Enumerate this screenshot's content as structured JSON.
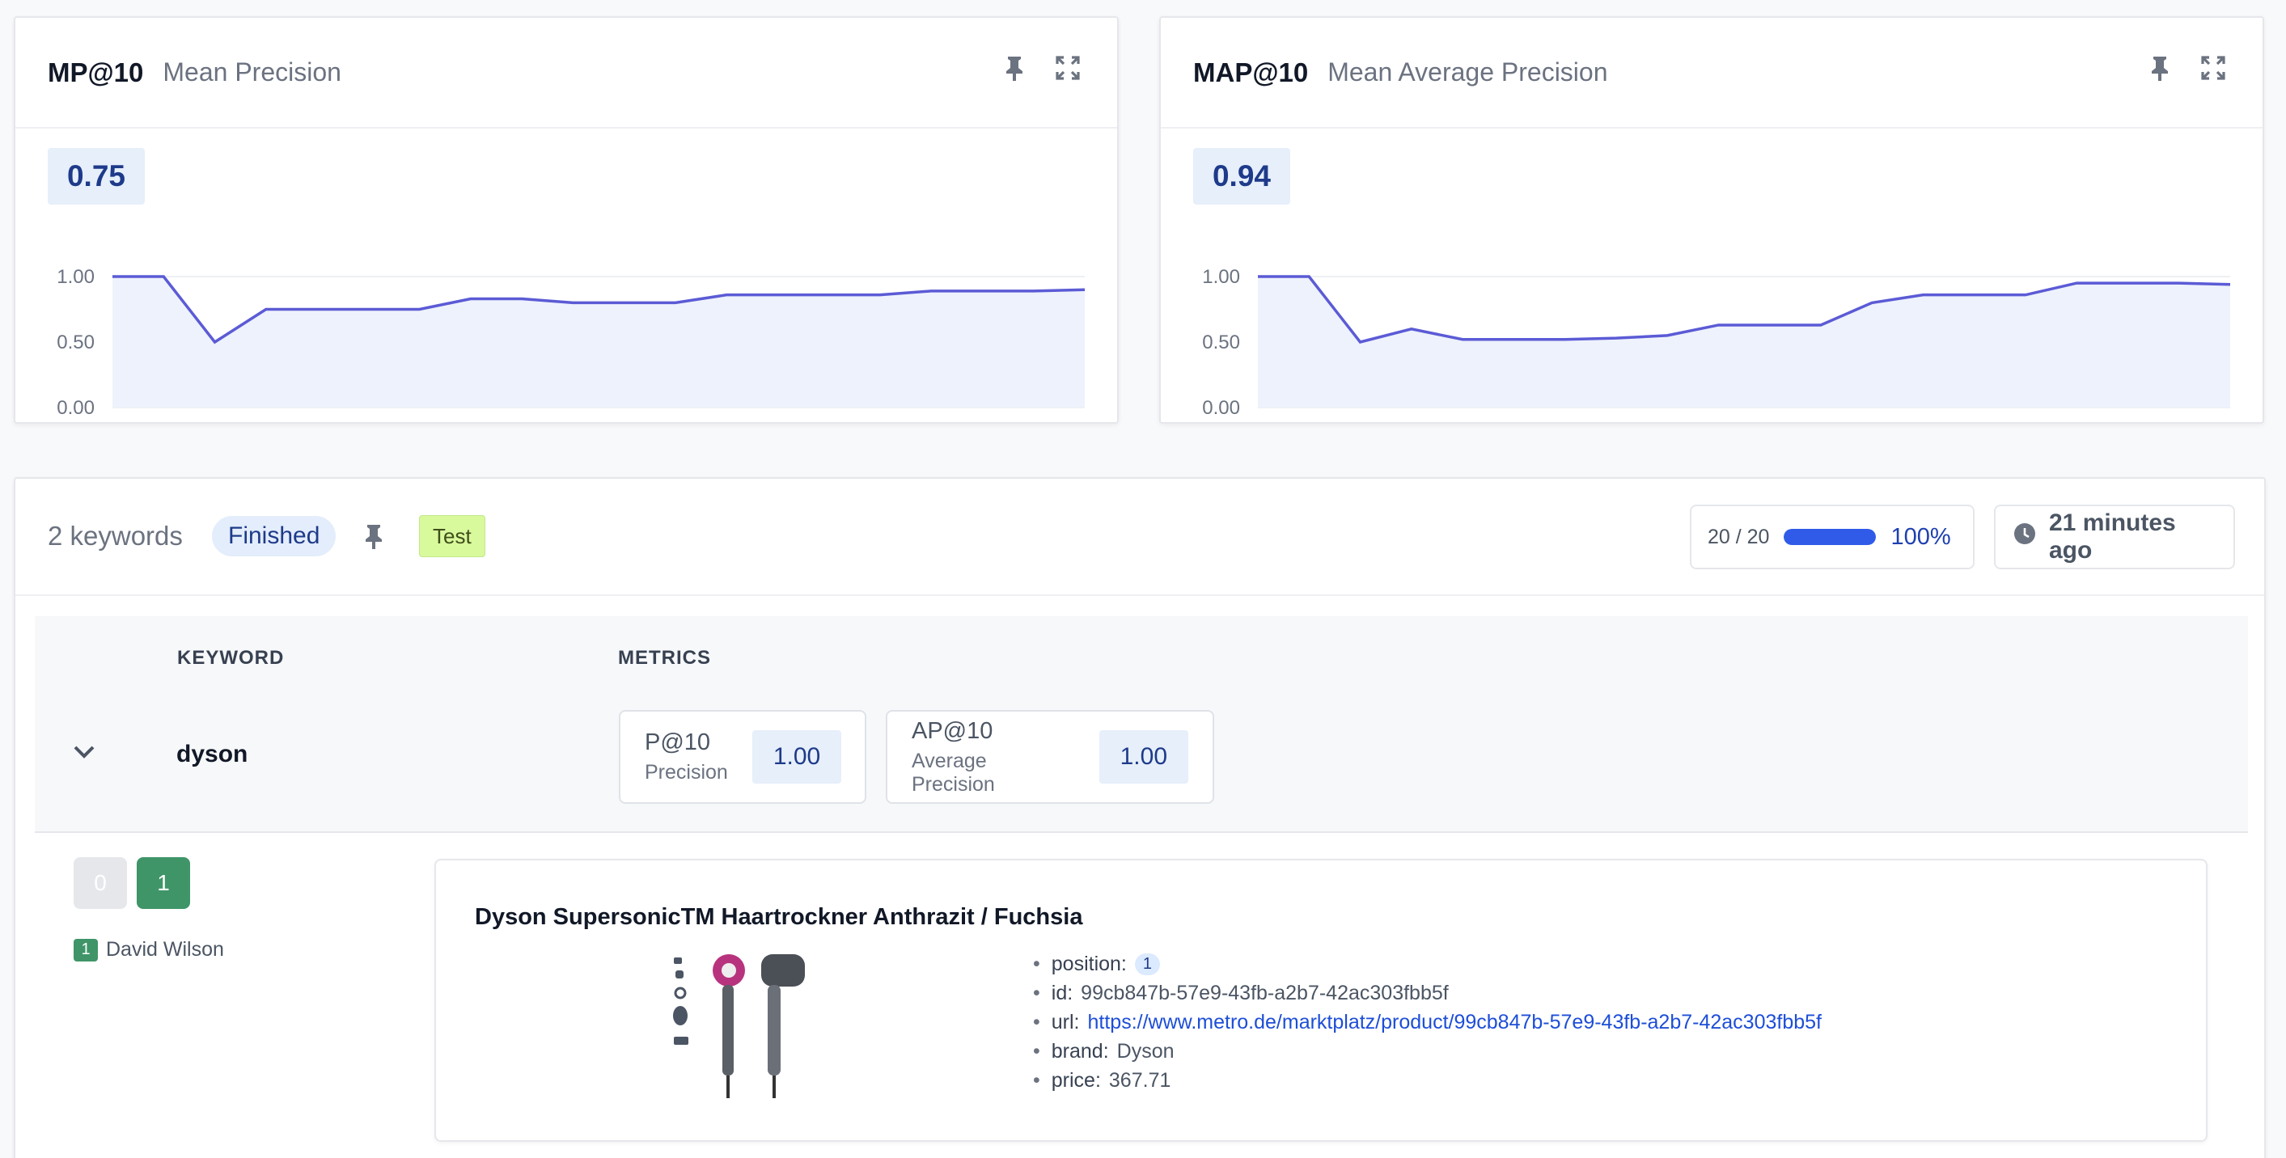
{
  "metric_cards": [
    {
      "code": "MP@10",
      "desc": "Mean Precision",
      "value": "0.75",
      "chart_data": {
        "type": "area",
        "x": [
          1,
          2,
          3,
          4,
          5,
          6,
          7,
          8,
          9,
          10,
          11,
          12,
          13,
          14,
          15,
          16,
          17,
          18,
          19,
          20
        ],
        "values": [
          1.0,
          1.0,
          0.5,
          0.75,
          0.75,
          0.75,
          0.75,
          0.83,
          0.83,
          0.8,
          0.8,
          0.8,
          0.86,
          0.86,
          0.86,
          0.86,
          0.89,
          0.89,
          0.89,
          0.9
        ],
        "ylim": [
          0,
          1
        ],
        "yticks": [
          "1.00",
          "0.50",
          "0.00"
        ],
        "grid": true
      }
    },
    {
      "code": "MAP@10",
      "desc": "Mean Average Precision",
      "value": "0.94",
      "chart_data": {
        "type": "area",
        "x": [
          1,
          2,
          3,
          4,
          5,
          6,
          7,
          8,
          9,
          10,
          11,
          12,
          13,
          14,
          15,
          16,
          17,
          18,
          19,
          20
        ],
        "values": [
          1.0,
          1.0,
          0.5,
          0.6,
          0.52,
          0.52,
          0.52,
          0.53,
          0.55,
          0.63,
          0.63,
          0.63,
          0.8,
          0.86,
          0.86,
          0.86,
          0.95,
          0.95,
          0.95,
          0.94
        ],
        "ylim": [
          0,
          1
        ],
        "yticks": [
          "1.00",
          "0.50",
          "0.00"
        ],
        "grid": true
      }
    }
  ],
  "results": {
    "keyword_count": "2 keywords",
    "status": "Finished",
    "tag": "Test",
    "progress_count": "20 / 20",
    "progress_fraction": 1.0,
    "progress_pct": "100%",
    "time_ago": "21 minutes ago"
  },
  "table": {
    "col_keyword": "KEYWORD",
    "col_metrics": "METRICS",
    "row": {
      "keyword": "dyson",
      "metrics": [
        {
          "code": "P@10",
          "label": "Precision",
          "value": "1.00"
        },
        {
          "code": "AP@10",
          "label": "Average Precision",
          "value": "1.00"
        }
      ]
    }
  },
  "judgement": {
    "btn0": "0",
    "btn1": "1",
    "assessor_score": "1",
    "assessor_name": "David Wilson"
  },
  "product": {
    "title": "Dyson SupersonicTM Haartrockner Anthrazit / Fuchsia",
    "attrs": {
      "position_key": "position:",
      "position_val": "1",
      "id_key": "id:",
      "id_val": "99cb847b-57e9-43fb-a2b7-42ac303fbb5f",
      "url_key": "url:",
      "url_val": "https://www.metro.de/marktplatz/product/99cb847b-57e9-43fb-a2b7-42ac303fbb5f",
      "brand_key": "brand:",
      "brand_val": "Dyson",
      "price_key": "price:",
      "price_val": "367.71"
    }
  },
  "colors": {
    "accent": "#5b5bd6",
    "area_fill": "#eef2fc",
    "success": "#3f9568",
    "progress": "#2f5be8"
  },
  "icons": [
    "pin-icon",
    "expand-icon",
    "chevron-down-icon",
    "clock-icon"
  ]
}
